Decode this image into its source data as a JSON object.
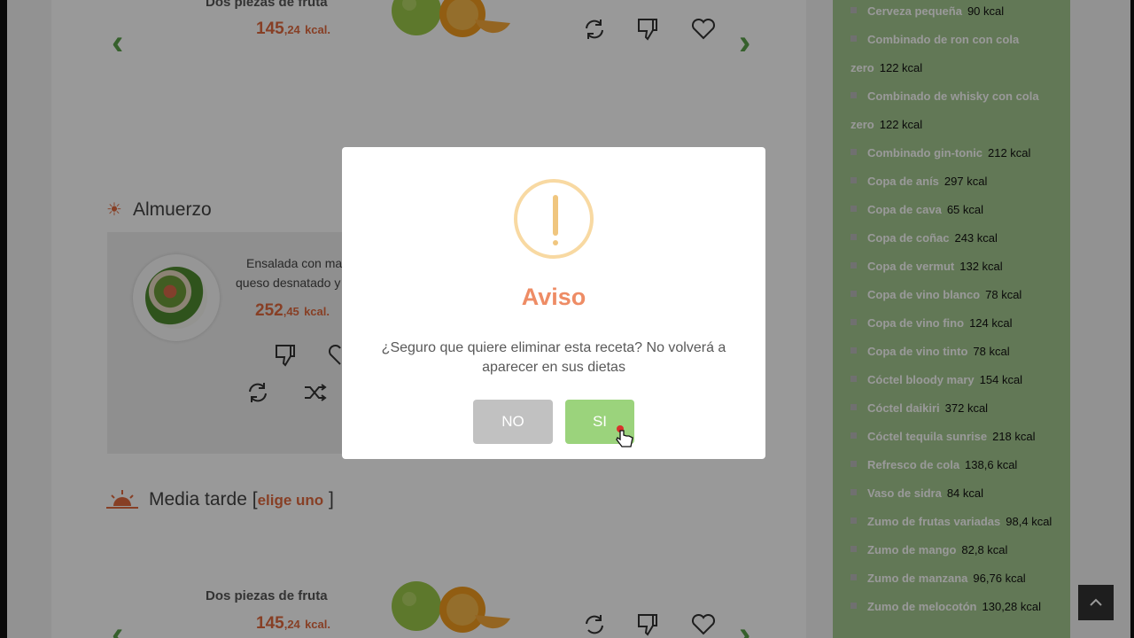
{
  "top_card": {
    "food_name": "Dos piezas de fruta",
    "kcal_main": "145",
    "kcal_decimal": ",24",
    "kcal_unit": "kcal."
  },
  "lunch": {
    "title": "Almuerzo",
    "food_name_line1": "Ensalada con ma",
    "food_name_line2": "queso desnatado y",
    "kcal_main": "252",
    "kcal_decimal": ",45",
    "kcal_unit": "kcal."
  },
  "afternoon": {
    "title": "Media tarde [",
    "choose_label": "elige uno",
    "title_end": " ]",
    "food_name": "Dos piezas de fruta",
    "kcal_main": "145",
    "kcal_decimal": ",24",
    "kcal_unit": "kcal."
  },
  "sidebar": {
    "items": [
      {
        "name": "Cerveza pequeña",
        "kcal": "90  kcal"
      },
      {
        "name": "Combinado de ron con cola zero",
        "kcal": "122  kcal"
      },
      {
        "name": "Combinado de whisky con cola zero",
        "kcal": "122  kcal"
      },
      {
        "name": "Combinado gin-tonic",
        "kcal": "212  kcal"
      },
      {
        "name": "Copa de anís",
        "kcal": "297  kcal"
      },
      {
        "name": "Copa de cava",
        "kcal": "65  kcal"
      },
      {
        "name": "Copa de coñac",
        "kcal": "243  kcal"
      },
      {
        "name": "Copa de vermut",
        "kcal": "132  kcal"
      },
      {
        "name": "Copa de vino blanco",
        "kcal": "78  kcal"
      },
      {
        "name": "Copa de vino fino",
        "kcal": "124  kcal"
      },
      {
        "name": "Copa de vino tinto",
        "kcal": "78  kcal"
      },
      {
        "name": "Cóctel bloody mary",
        "kcal": "154  kcal"
      },
      {
        "name": "Cóctel daikiri",
        "kcal": "372  kcal"
      },
      {
        "name": "Cóctel tequila sunrise",
        "kcal": "218  kcal"
      },
      {
        "name": "Refresco de cola",
        "kcal": "138,6  kcal"
      },
      {
        "name": "Vaso de sidra",
        "kcal": "84  kcal"
      },
      {
        "name": "Zumo de frutas variadas",
        "kcal": "98,4  kcal"
      },
      {
        "name": "Zumo de mango",
        "kcal": "82,8  kcal"
      },
      {
        "name": "Zumo de manzana",
        "kcal": "96,76  kcal"
      },
      {
        "name": "Zumo de melocotón",
        "kcal": "130,28  kcal"
      }
    ]
  },
  "modal": {
    "title": "Aviso",
    "message": "¿Seguro que quiere eliminar esta receta? No volverá a aparecer en sus dietas",
    "no_label": "NO",
    "yes_label": "SI"
  },
  "colors": {
    "accent_orange": "#e26a3f",
    "green_arrow": "#5aa14a",
    "sidebar_green": "#a4c98f",
    "warning": "#f0c67f",
    "yes_button": "#9bd37c",
    "no_button": "#c1c1c1"
  },
  "icons": [
    "chevron-left-icon",
    "chevron-right-icon",
    "refresh-icon",
    "thumbs-down-icon",
    "heart-icon",
    "shuffle-icon",
    "sun-icon",
    "sunset-icon",
    "warning-icon",
    "arrow-up-icon",
    "hand-cursor-icon"
  ]
}
